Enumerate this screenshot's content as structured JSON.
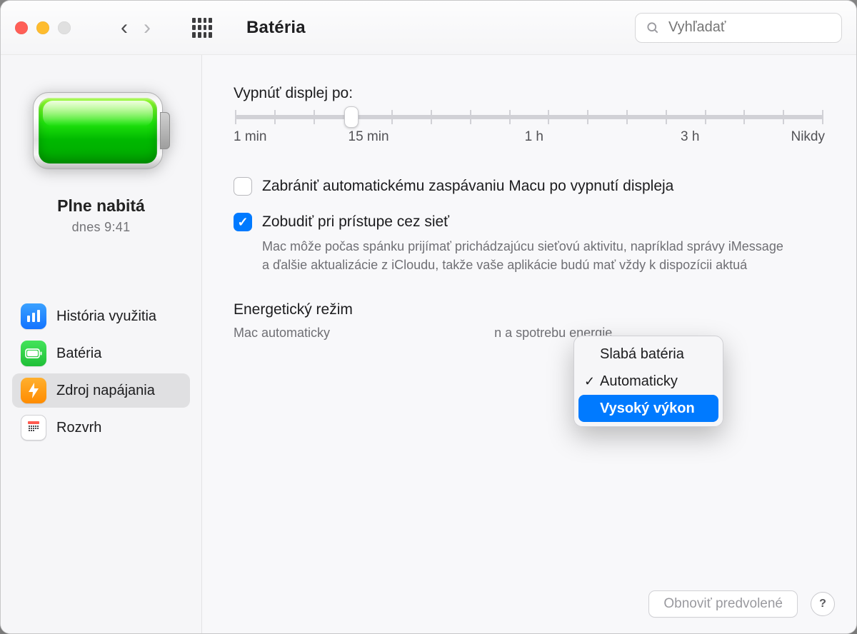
{
  "header": {
    "title": "Batéria",
    "search_placeholder": "Vyhľadať"
  },
  "sidebar": {
    "status_title": "Plne nabitá",
    "status_subtitle": "dnes  9:41",
    "items": [
      {
        "icon": "chart-bar-icon",
        "label": "História využitia"
      },
      {
        "icon": "battery-icon",
        "label": "Batéria"
      },
      {
        "icon": "bolt-icon",
        "label": "Zdroj napájania",
        "selected": true
      },
      {
        "icon": "schedule-icon",
        "label": "Rozvrh"
      }
    ]
  },
  "main": {
    "display_off_label": "Vypnúť displej po:",
    "slider_labels": [
      "1 min",
      "15 min",
      "1 h",
      "3 h",
      "Nikdy"
    ],
    "cb_prevent_sleep": {
      "checked": false,
      "label": "Zabrániť automatickému zaspávaniu Macu po vypnutí displeja"
    },
    "cb_wake_network": {
      "checked": true,
      "label": "Zobudiť pri prístupe cez sieť",
      "desc": "Mac môže počas spánku prijímať prichádzajúcu sieťovú aktivitu, napríklad správy iMessage a ďalšie aktualizácie z iCloudu, takže vaše aplikácie budú mať vždy k dispozícii aktuá"
    },
    "energy_mode": {
      "label_left": "Energetický režim",
      "desc_left": "Mac automaticky",
      "desc_right": "n a spotrebu energie.",
      "options": [
        {
          "label": "Slabá batéria"
        },
        {
          "label": "Automaticky",
          "checked": true
        },
        {
          "label": "Vysoký výkon",
          "highlighted": true
        }
      ]
    }
  },
  "footer": {
    "restore_defaults": "Obnoviť predvolené",
    "help": "?"
  }
}
